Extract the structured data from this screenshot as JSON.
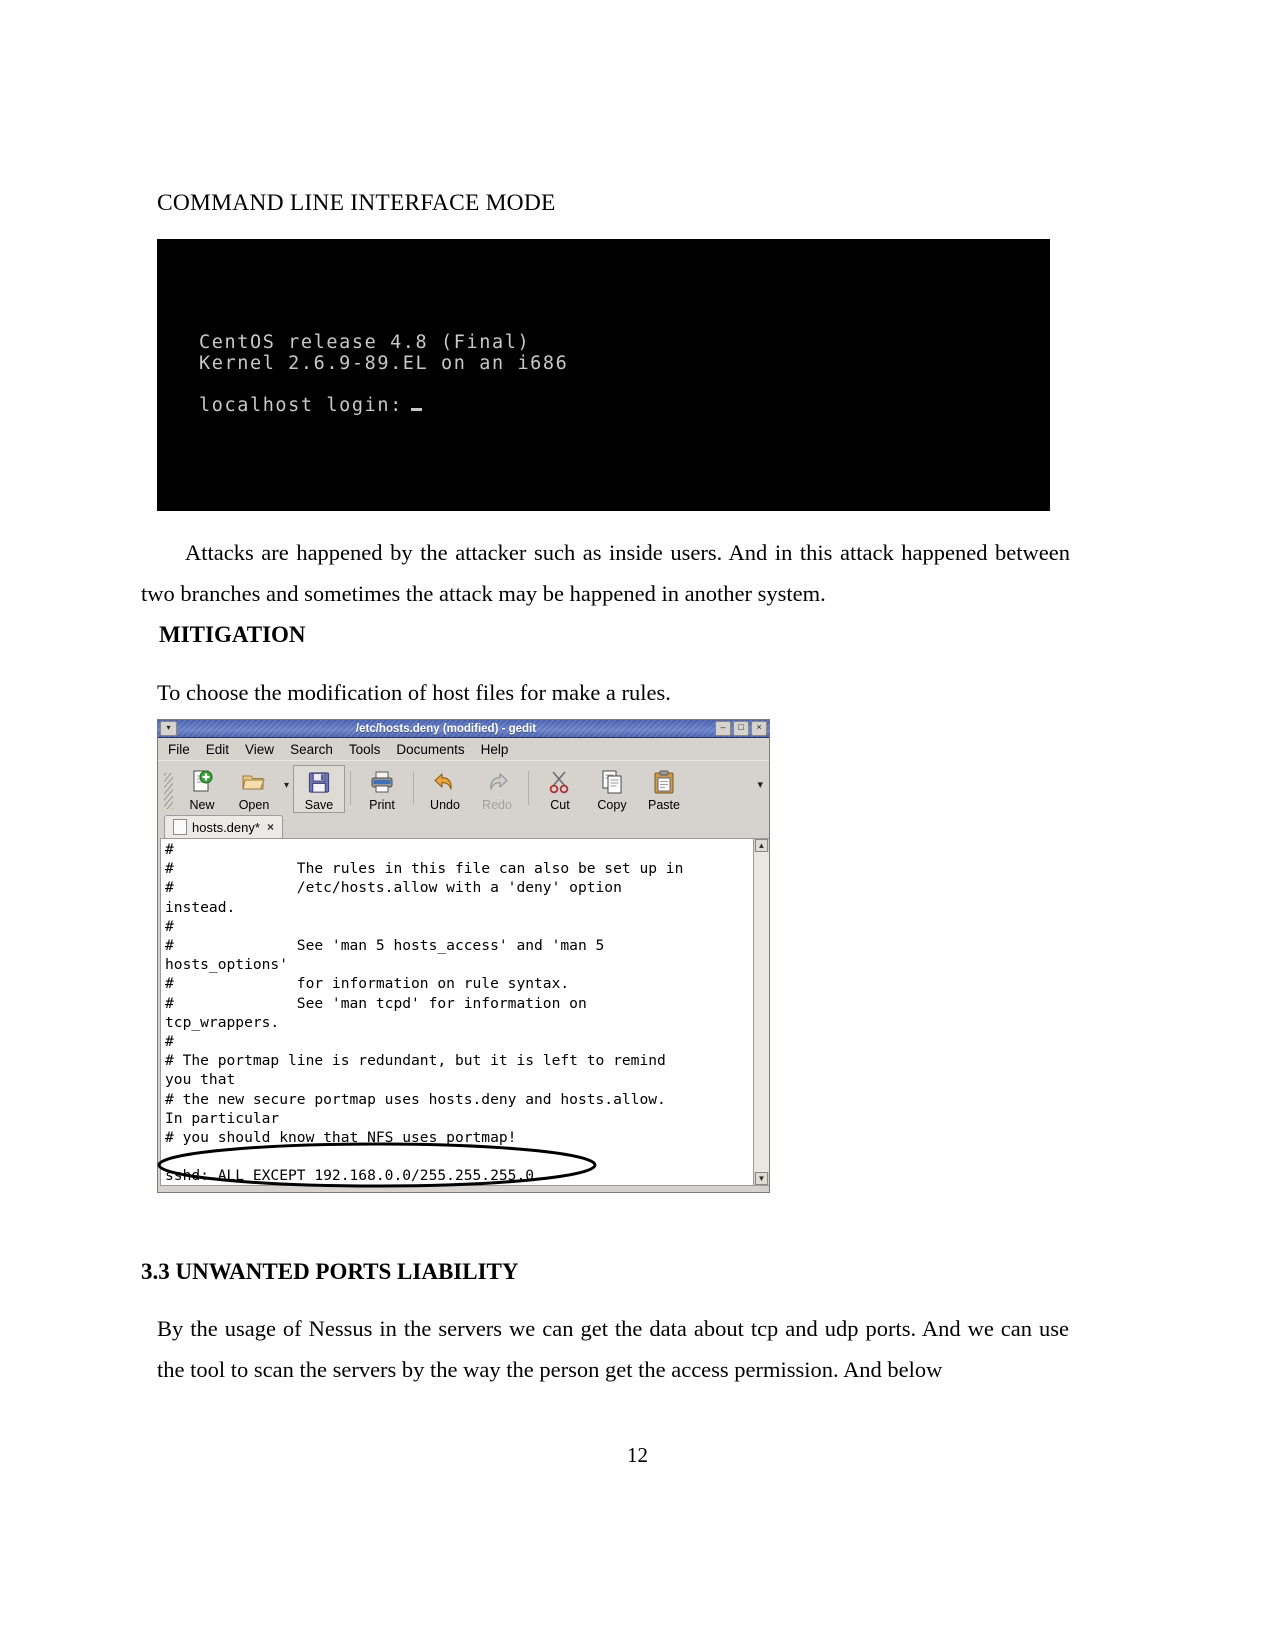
{
  "document": {
    "heading": "COMMAND LINE INTERFACE MODE",
    "paragraph_1": "Attacks are happened by the attacker such as inside users. And in this attack happened between two branches and sometimes the attack may be happened in another system.",
    "mitigation_heading": "MITIGATION",
    "paragraph_2": "To choose the modification of host files for make a rules.",
    "section_heading": "3.3 UNWANTED PORTS LIABILITY",
    "paragraph_3": "By the usage of Nessus in the servers we can get the data about tcp and udp ports. And we can use the tool to scan the servers by the way the person get the access permission. And below",
    "page_number": "12"
  },
  "terminal": {
    "line_1": "CentOS release 4.8 (Final)",
    "line_2": "Kernel 2.6.9-89.EL on an i686",
    "login_prompt": "localhost login:",
    "background": "#000000",
    "text_color": "#c8c8c8"
  },
  "gedit": {
    "window_title": "/etc/hosts.deny (modified) - gedit",
    "window_menu_icon": "window-menu-icon",
    "window_buttons": [
      {
        "name": "minimize-button",
        "glyph": "–"
      },
      {
        "name": "maximize-button",
        "glyph": "□"
      },
      {
        "name": "close-button",
        "glyph": "×"
      }
    ],
    "menus": [
      {
        "label": "File",
        "mnemonic": "F"
      },
      {
        "label": "Edit",
        "mnemonic": "E"
      },
      {
        "label": "View",
        "mnemonic": "V"
      },
      {
        "label": "Search",
        "mnemonic": "e"
      },
      {
        "label": "Tools",
        "mnemonic": "T"
      },
      {
        "label": "Documents",
        "mnemonic": "D"
      },
      {
        "label": "Help",
        "mnemonic": "H"
      }
    ],
    "toolbar": [
      {
        "label": "New",
        "icon": "new-document-icon",
        "enabled": true,
        "framed": false
      },
      {
        "label": "Open",
        "icon": "open-folder-icon",
        "enabled": true,
        "framed": false
      },
      {
        "label": "Save",
        "icon": "save-floppy-icon",
        "enabled": true,
        "framed": true
      },
      {
        "label": "Print",
        "icon": "print-icon",
        "enabled": true,
        "framed": false
      },
      {
        "label": "Undo",
        "icon": "undo-arrow-icon",
        "enabled": true,
        "framed": false
      },
      {
        "label": "Redo",
        "icon": "redo-arrow-icon",
        "enabled": false,
        "framed": false
      },
      {
        "label": "Cut",
        "icon": "cut-scissors-icon",
        "enabled": true,
        "framed": false
      },
      {
        "label": "Copy",
        "icon": "copy-icon",
        "enabled": true,
        "framed": false
      },
      {
        "label": "Paste",
        "icon": "paste-clipboard-icon",
        "enabled": true,
        "framed": false
      }
    ],
    "tab": {
      "label": "hosts.deny*",
      "close_glyph": "×"
    },
    "editor_text": "#\n#              The rules in this file can also be set up in\n#              /etc/hosts.allow with a 'deny' option\ninstead.\n#\n#              See 'man 5 hosts_access' and 'man 5\nhosts_options'\n#              for information on rule syntax.\n#              See 'man tcpd' for information on\ntcp_wrappers.\n#\n# The portmap line is redundant, but it is left to remind\nyou that\n# the new secure portmap uses hosts.deny and hosts.allow.\nIn particular\n# you should know that NFS uses portmap!\n\nsshd: ALL EXCEPT 192.168.0.0/255.255.255.0",
    "highlighted_rule": "sshd: ALL EXCEPT 192.168.0.0/255.255.255.0",
    "scrollbar": {
      "up_glyph": "▲",
      "down_glyph": "▼"
    },
    "titlebar_color": "#4a62ad",
    "chrome_color": "#d6d3ce"
  }
}
